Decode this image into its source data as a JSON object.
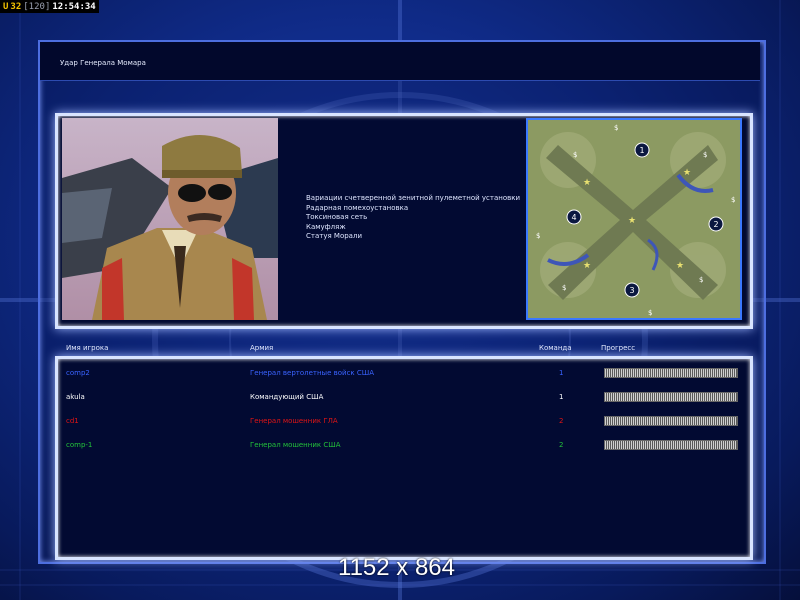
{
  "hud": {
    "prefix": "U",
    "fps": "32",
    "limit": "[120]",
    "time": "12:54:34"
  },
  "mission": {
    "title": "Удар Генерала Момара",
    "description_lines": [
      "Вариации счетверенной зенитной пулеметной установки",
      "Радарная помехоустановка",
      "Токсиновая сеть",
      "Камуфляж",
      "Статуя Морали"
    ]
  },
  "map": {
    "start_positions": [
      "1",
      "2",
      "3",
      "4"
    ]
  },
  "table": {
    "headers": {
      "player": "Имя игрока",
      "army": "Армия",
      "team": "Команда",
      "progress": "Прогресс"
    },
    "rows": [
      {
        "player": "comp2",
        "army": "Генерал вертолетные войск США",
        "team": "1",
        "color": "#3a63ff",
        "progress": 1.0
      },
      {
        "player": "akula",
        "army": "Командующий США",
        "team": "1",
        "color": "#ffffff",
        "progress": 1.0
      },
      {
        "player": "cd1",
        "army": "Генерал мошенник ГЛА",
        "team": "2",
        "color": "#e01515",
        "progress": 1.0
      },
      {
        "player": "comp-1",
        "army": "Генерал мошенник США",
        "team": "2",
        "color": "#23c23a",
        "progress": 1.0
      }
    ]
  },
  "resolution_overlay": "1152 x 864"
}
